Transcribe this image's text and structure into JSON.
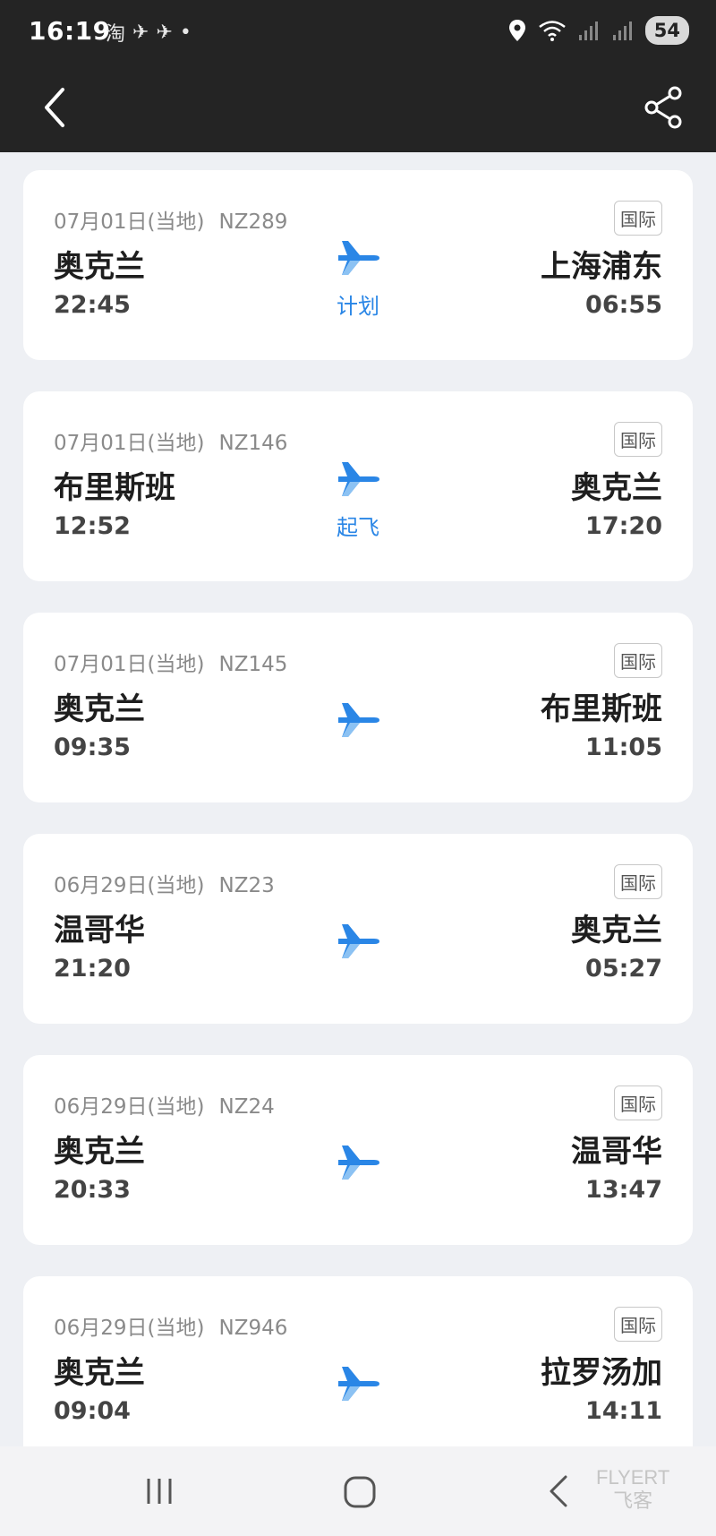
{
  "status_bar": {
    "time": "16:19",
    "app_icons": [
      "淘",
      "✈",
      "✈",
      "•"
    ],
    "battery": "54"
  },
  "header": {
    "back_icon": "chevron-left-icon",
    "share_icon": "share-icon"
  },
  "flights": [
    {
      "date": "07月01日(当地)",
      "flight_no": "NZ289",
      "tag": "国际",
      "dep_city": "奥克兰",
      "dep_time": "22:45",
      "arr_city": "上海浦东",
      "arr_time": "06:55",
      "status": "计划"
    },
    {
      "date": "07月01日(当地)",
      "flight_no": "NZ146",
      "tag": "国际",
      "dep_city": "布里斯班",
      "dep_time": "12:52",
      "arr_city": "奥克兰",
      "arr_time": "17:20",
      "status": "起飞"
    },
    {
      "date": "07月01日(当地)",
      "flight_no": "NZ145",
      "tag": "国际",
      "dep_city": "奥克兰",
      "dep_time": "09:35",
      "arr_city": "布里斯班",
      "arr_time": "11:05",
      "status": ""
    },
    {
      "date": "06月29日(当地)",
      "flight_no": "NZ23",
      "tag": "国际",
      "dep_city": "温哥华",
      "dep_time": "21:20",
      "arr_city": "奥克兰",
      "arr_time": "05:27",
      "status": ""
    },
    {
      "date": "06月29日(当地)",
      "flight_no": "NZ24",
      "tag": "国际",
      "dep_city": "奥克兰",
      "dep_time": "20:33",
      "arr_city": "温哥华",
      "arr_time": "13:47",
      "status": ""
    },
    {
      "date": "06月29日(当地)",
      "flight_no": "NZ946",
      "tag": "国际",
      "dep_city": "奥克兰",
      "dep_time": "09:04",
      "arr_city": "拉罗汤加",
      "arr_time": "14:11",
      "status": ""
    }
  ],
  "nav_bar": {
    "watermark_line1": "FLYERT",
    "watermark_line2": "飞客"
  },
  "colors": {
    "accent": "#2a86e6",
    "header_bg": "#242424",
    "page_bg": "#eef0f4"
  }
}
